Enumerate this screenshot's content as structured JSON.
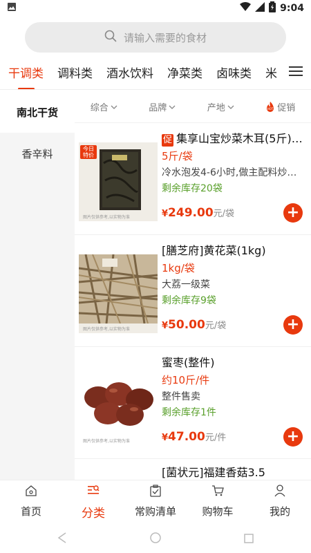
{
  "status_bar": {
    "time": "9:04"
  },
  "search": {
    "placeholder": "请输入需要的食材"
  },
  "categories": [
    {
      "label": "干调类",
      "active": true
    },
    {
      "label": "调料类"
    },
    {
      "label": "酒水饮料"
    },
    {
      "label": "净菜类"
    },
    {
      "label": "卤味类"
    },
    {
      "label": "米"
    }
  ],
  "sidebar": {
    "items": [
      {
        "label": "南北干货",
        "active": true
      },
      {
        "label": "香辛料"
      }
    ]
  },
  "filters": {
    "comprehensive": "综合",
    "brand": "品牌",
    "origin": "产地",
    "promo": "促销",
    "hot_badge": "HOT"
  },
  "image_caption": "图片仅供参考,以实物为准",
  "products": [
    {
      "promo_tag": "促",
      "title": "集享山宝炒菜木耳(5斤)(...",
      "spec": "5斤/袋",
      "desc": "冷水泡发4-6小时,做主配料炒菜...",
      "stock": "剩余库存20袋",
      "currency": "¥",
      "price": "249.00",
      "unit": "元/袋",
      "badge": "今日特价"
    },
    {
      "title": "[膳芝府]黄花菜(1kg)",
      "spec": "1kg/袋",
      "desc": "大荔一级菜",
      "stock": "剩余库存9袋",
      "currency": "¥",
      "price": "50.00",
      "unit": "元/袋"
    },
    {
      "title": "蜜枣(整件)",
      "spec": "约10斤/件",
      "desc": "整件售卖",
      "stock": "剩余库存1件",
      "currency": "¥",
      "price": "47.00",
      "unit": "元/件"
    },
    {
      "title": "[菌状元]福建香菇3.5"
    }
  ],
  "tabbar": [
    {
      "label": "首页",
      "icon": "home-icon"
    },
    {
      "label": "分类",
      "icon": "category-icon",
      "active": true
    },
    {
      "label": "常购清单",
      "icon": "clipboard-icon"
    },
    {
      "label": "购物车",
      "icon": "cart-icon"
    },
    {
      "label": "我的",
      "icon": "person-icon"
    }
  ],
  "colors": {
    "accent": "#e8390e",
    "stock_green": "#5aa02c"
  }
}
